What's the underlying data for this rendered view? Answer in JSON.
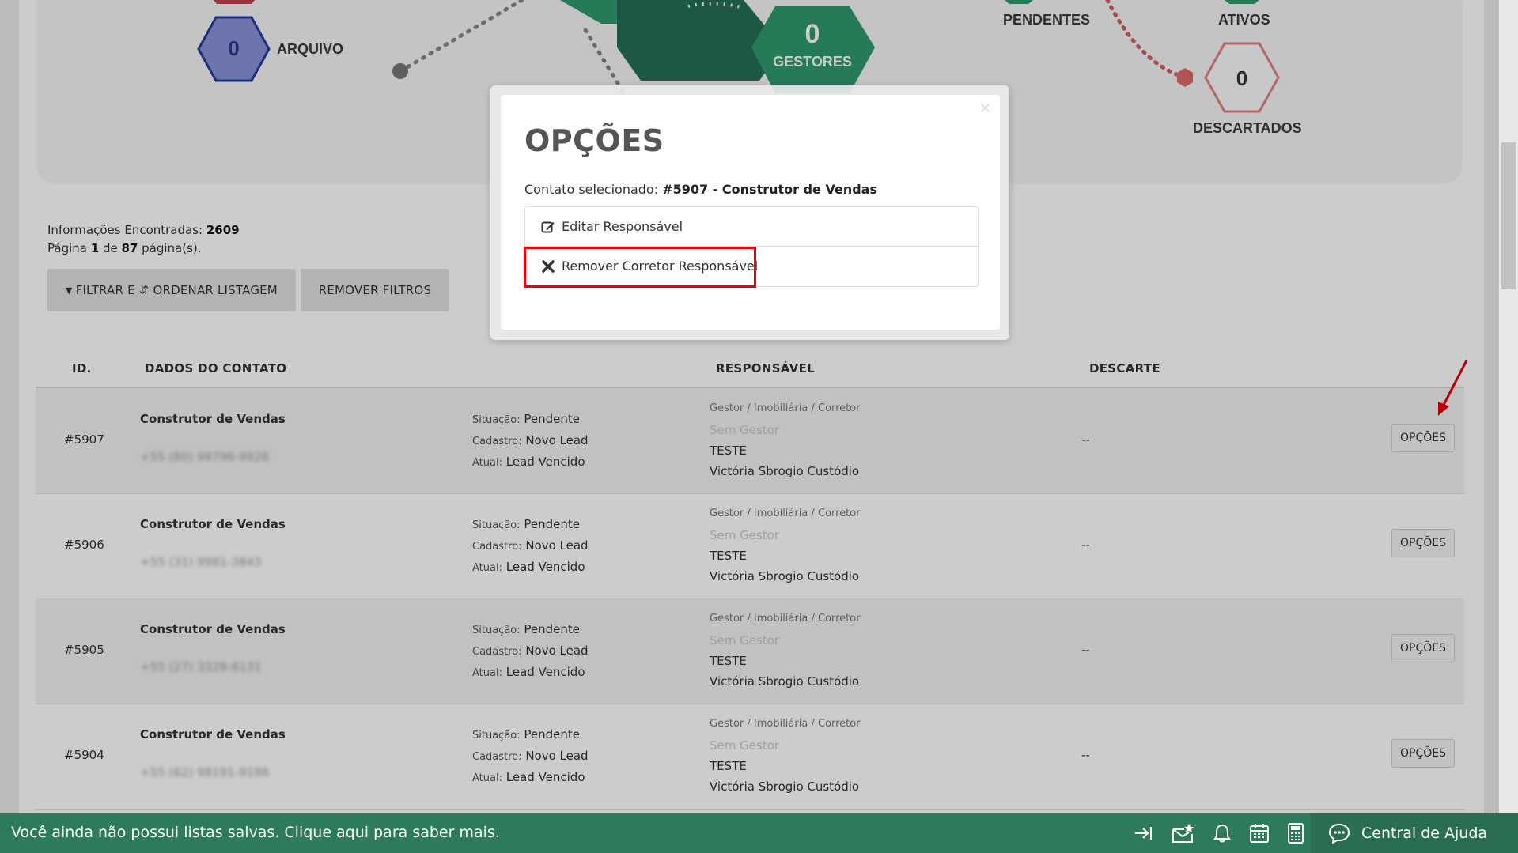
{
  "dashboard": {
    "arquivo": {
      "value": "0",
      "label": "ARQUIVO"
    },
    "gestores": {
      "value": "0",
      "label": "GESTORES"
    },
    "pendentes": {
      "label": "PENDENTES"
    },
    "ativos": {
      "label": "ATIVOS"
    },
    "descartados": {
      "value": "0",
      "label": "DESCARTADOS"
    }
  },
  "info": {
    "found_label": "Informações Encontradas:",
    "found_count": "2609",
    "page_prefix": "Página",
    "page_current": "1",
    "page_of": "de",
    "page_total": "87",
    "page_suffix": "página(s)."
  },
  "buttons": {
    "filter_label": "FILTRAR E ⇵ ORDENAR LISTAGEM",
    "remove_filters": "REMOVER FILTROS"
  },
  "table": {
    "headers": {
      "id": "ID.",
      "contact": "DADOS DO CONTATO",
      "responsible": "RESPONSÁVEL",
      "discard": "DESCARTE"
    },
    "rows": [
      {
        "id": "#5907",
        "name": "Construtor de Vendas",
        "phone": "+55 (80) 98796-9926",
        "situacao": "Pendente",
        "cadastro": "Novo Lead",
        "atual": "Lead Vencido",
        "resp_header": "Gestor / Imobiliária / Corretor",
        "gestor": "Sem Gestor",
        "imob": "TESTE",
        "corretor": "Victória Sbrogio Custódio",
        "descarte": "--",
        "opt": "OPÇÕES"
      },
      {
        "id": "#5906",
        "name": "Construtor de Vendas",
        "phone": "+55 (31) 9981-3843",
        "situacao": "Pendente",
        "cadastro": "Novo Lead",
        "atual": "Lead Vencido",
        "resp_header": "Gestor / Imobiliária / Corretor",
        "gestor": "Sem Gestor",
        "imob": "TESTE",
        "corretor": "Victória Sbrogio Custódio",
        "descarte": "--",
        "opt": "OPÇÕES"
      },
      {
        "id": "#5905",
        "name": "Construtor de Vendas",
        "phone": "+55 (27) 3328-6131",
        "situacao": "Pendente",
        "cadastro": "Novo Lead",
        "atual": "Lead Vencido",
        "resp_header": "Gestor / Imobiliária / Corretor",
        "gestor": "Sem Gestor",
        "imob": "TESTE",
        "corretor": "Victória Sbrogio Custódio",
        "descarte": "--",
        "opt": "OPÇÕES"
      },
      {
        "id": "#5904",
        "name": "Construtor de Vendas",
        "phone": "+55 (62) 98191-9186",
        "situacao": "Pendente",
        "cadastro": "Novo Lead",
        "atual": "Lead Vencido",
        "resp_header": "Gestor / Imobiliária / Corretor",
        "gestor": "Sem Gestor",
        "imob": "TESTE",
        "corretor": "Victória Sbrogio Custódio",
        "descarte": "--",
        "opt": "OPÇÕES"
      }
    ],
    "labels": {
      "situacao": "Situação:",
      "cadastro": "Cadastro:",
      "atual": "Atual:"
    }
  },
  "modal": {
    "title": "OPÇÕES",
    "close": "×",
    "selected_label": "Contato selecionado:",
    "selected_value": "#5907 - Construtor de Vendas",
    "options": [
      "Editar Responsável",
      "Remover Corretor Responsável"
    ]
  },
  "bottom_bar": {
    "message": "Você ainda não possui listas salvas. Clique aqui para saber mais.",
    "help": "Central de Ajuda"
  },
  "colors": {
    "green": "#2e7a5c",
    "hex_blue": "#2a3a8c",
    "hex_green": "#2e8b62",
    "hex_red": "#e08080",
    "highlight": "#e8000b"
  }
}
